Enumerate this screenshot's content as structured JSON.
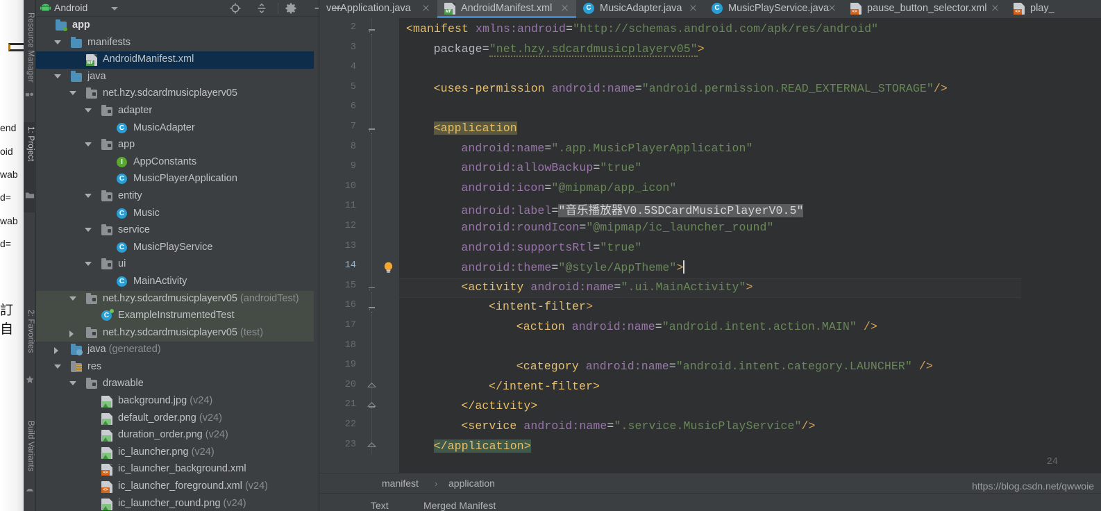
{
  "background_window": {
    "fragments": [
      "end",
      "oid",
      "wab",
      "d=",
      "wab",
      "d="
    ],
    "cjk_fragment": "訂自"
  },
  "tool_strip": {
    "items": [
      {
        "label": "Resource Manager",
        "icon": "resource-manager-icon",
        "active": false
      },
      {
        "label": "1: Project",
        "icon": "project-folder-icon",
        "active": true
      },
      {
        "label": "2: Favorites",
        "icon": "star-icon",
        "active": false
      },
      {
        "label": "Build Variants",
        "icon": "build-variants-icon",
        "active": false
      }
    ]
  },
  "project_panel": {
    "title": "Android",
    "dropdown_icon": "chevron-down-icon",
    "android_icon": "android-robot-icon",
    "header_icons": [
      "locate-target-icon",
      "collapse-all-icon",
      "gear-icon",
      "minimize-icon"
    ],
    "tree": [
      {
        "label": "app",
        "suffix": "",
        "depth": 0,
        "icon": "folder-module",
        "arrow": "",
        "bold": true,
        "selected": false,
        "testbg": false
      },
      {
        "label": "manifests",
        "suffix": "",
        "depth": 1,
        "icon": "folder-blue",
        "arrow": "open",
        "bold": false,
        "selected": false,
        "testbg": false
      },
      {
        "label": "AndroidManifest.xml",
        "suffix": "",
        "depth": 2,
        "icon": "file-mf",
        "arrow": "",
        "bold": false,
        "selected": true,
        "testbg": false
      },
      {
        "label": "java",
        "suffix": "",
        "depth": 1,
        "icon": "folder-blue",
        "arrow": "open",
        "bold": false,
        "selected": false,
        "testbg": false
      },
      {
        "label": "net.hzy.sdcardmusicplayerv05",
        "suffix": "",
        "depth": 2,
        "icon": "folder-pkg",
        "arrow": "open",
        "bold": false,
        "selected": false,
        "testbg": false
      },
      {
        "label": "adapter",
        "suffix": "",
        "depth": 3,
        "icon": "folder-pkg",
        "arrow": "open",
        "bold": false,
        "selected": false,
        "testbg": false
      },
      {
        "label": "MusicAdapter",
        "suffix": "",
        "depth": 4,
        "icon": "class",
        "arrow": "",
        "bold": false,
        "selected": false,
        "testbg": false
      },
      {
        "label": "app",
        "suffix": "",
        "depth": 3,
        "icon": "folder-pkg",
        "arrow": "open",
        "bold": false,
        "selected": false,
        "testbg": false
      },
      {
        "label": "AppConstants",
        "suffix": "",
        "depth": 4,
        "icon": "interface",
        "arrow": "",
        "bold": false,
        "selected": false,
        "testbg": false
      },
      {
        "label": "MusicPlayerApplication",
        "suffix": "",
        "depth": 4,
        "icon": "class",
        "arrow": "",
        "bold": false,
        "selected": false,
        "testbg": false
      },
      {
        "label": "entity",
        "suffix": "",
        "depth": 3,
        "icon": "folder-pkg",
        "arrow": "open",
        "bold": false,
        "selected": false,
        "testbg": false
      },
      {
        "label": "Music",
        "suffix": "",
        "depth": 4,
        "icon": "class",
        "arrow": "",
        "bold": false,
        "selected": false,
        "testbg": false
      },
      {
        "label": "service",
        "suffix": "",
        "depth": 3,
        "icon": "folder-pkg",
        "arrow": "open",
        "bold": false,
        "selected": false,
        "testbg": false
      },
      {
        "label": "MusicPlayService",
        "suffix": "",
        "depth": 4,
        "icon": "class",
        "arrow": "",
        "bold": false,
        "selected": false,
        "testbg": false
      },
      {
        "label": "ui",
        "suffix": "",
        "depth": 3,
        "icon": "folder-pkg",
        "arrow": "open",
        "bold": false,
        "selected": false,
        "testbg": false
      },
      {
        "label": "MainActivity",
        "suffix": "",
        "depth": 4,
        "icon": "class",
        "arrow": "",
        "bold": false,
        "selected": false,
        "testbg": false
      },
      {
        "label": "net.hzy.sdcardmusicplayerv05",
        "suffix": " (androidTest)",
        "depth": 2,
        "icon": "folder-pkg",
        "arrow": "open",
        "bold": false,
        "selected": false,
        "testbg": true
      },
      {
        "label": "ExampleInstrumentedTest",
        "suffix": "",
        "depth": 3,
        "icon": "class-test",
        "arrow": "",
        "bold": false,
        "selected": false,
        "testbg": true
      },
      {
        "label": "net.hzy.sdcardmusicplayerv05",
        "suffix": " (test)",
        "depth": 2,
        "icon": "folder-pkg",
        "arrow": "closed",
        "bold": false,
        "selected": false,
        "testbg": true
      },
      {
        "label": "java",
        "suffix": " (generated)",
        "depth": 1,
        "icon": "folder-generated",
        "arrow": "closed",
        "bold": false,
        "selected": false,
        "testbg": false
      },
      {
        "label": "res",
        "suffix": "",
        "depth": 1,
        "icon": "folder-res",
        "arrow": "open",
        "bold": false,
        "selected": false,
        "testbg": false
      },
      {
        "label": "drawable",
        "suffix": "",
        "depth": 2,
        "icon": "folder-pkg",
        "arrow": "open",
        "bold": false,
        "selected": false,
        "testbg": false
      },
      {
        "label": "background.jpg",
        "suffix": " (v24)",
        "depth": 3,
        "icon": "file-image",
        "arrow": "",
        "bold": false,
        "selected": false,
        "testbg": false
      },
      {
        "label": "default_order.png",
        "suffix": " (v24)",
        "depth": 3,
        "icon": "file-image",
        "arrow": "",
        "bold": false,
        "selected": false,
        "testbg": false
      },
      {
        "label": "duration_order.png",
        "suffix": " (v24)",
        "depth": 3,
        "icon": "file-image",
        "arrow": "",
        "bold": false,
        "selected": false,
        "testbg": false
      },
      {
        "label": "ic_launcher.png",
        "suffix": " (v24)",
        "depth": 3,
        "icon": "file-image",
        "arrow": "",
        "bold": false,
        "selected": false,
        "testbg": false
      },
      {
        "label": "ic_launcher_background.xml",
        "suffix": "",
        "depth": 3,
        "icon": "file-xml",
        "arrow": "",
        "bold": false,
        "selected": false,
        "testbg": false
      },
      {
        "label": "ic_launcher_foreground.xml",
        "suffix": " (v24)",
        "depth": 3,
        "icon": "file-xml",
        "arrow": "",
        "bold": false,
        "selected": false,
        "testbg": false
      },
      {
        "label": "ic_launcher_round.png",
        "suffix": " (v24)",
        "depth": 3,
        "icon": "file-image",
        "arrow": "",
        "bold": false,
        "selected": false,
        "testbg": false
      }
    ]
  },
  "editor_tabs": [
    {
      "label": "verApplication.java",
      "icon": "java-class-icon",
      "active": false,
      "truncated_left": true
    },
    {
      "label": "AndroidManifest.xml",
      "icon": "manifest-file-icon",
      "active": true,
      "truncated_left": false
    },
    {
      "label": "MusicAdapter.java",
      "icon": "java-class-icon",
      "active": false,
      "truncated_left": false
    },
    {
      "label": "MusicPlayService.java",
      "icon": "java-class-icon",
      "active": false,
      "truncated_left": false
    },
    {
      "label": "pause_button_selector.xml",
      "icon": "xml-file-icon",
      "active": false,
      "truncated_left": false
    },
    {
      "label": "play_",
      "icon": "xml-file-icon",
      "active": false,
      "truncated_left": false
    }
  ],
  "code": {
    "first_visible_line": 2,
    "last_visible_line": 24,
    "current_line": 14,
    "lines": [
      {
        "n": 2,
        "fold": "minus-top",
        "segs": [
          {
            "t": "<manifest",
            "c": "tag"
          },
          {
            "t": " ",
            "c": "plain"
          },
          {
            "t": "xmlns:android",
            "c": "attr"
          },
          {
            "t": "=",
            "c": "eq"
          },
          {
            "t": "\"http://schemas.android.com/apk/res/android\"",
            "c": "str"
          }
        ],
        "indent": 0
      },
      {
        "n": 3,
        "fold": "",
        "segs": [
          {
            "t": "package",
            "c": "attrname"
          },
          {
            "t": "=",
            "c": "eq"
          },
          {
            "t": "\"net.hzy.sdcardmusicplayerv05\"",
            "c": "str-squiggle"
          },
          {
            "t": ">",
            "c": "punct"
          }
        ],
        "indent": 4
      },
      {
        "n": 4,
        "fold": "",
        "segs": [],
        "indent": 0
      },
      {
        "n": 5,
        "fold": "",
        "segs": [
          {
            "t": "<uses-permission",
            "c": "tag"
          },
          {
            "t": " ",
            "c": "plain"
          },
          {
            "t": "android:name",
            "c": "attr"
          },
          {
            "t": "=",
            "c": "eq"
          },
          {
            "t": "\"android.permission.READ_EXTERNAL_STORAGE\"",
            "c": "str"
          },
          {
            "t": "/>",
            "c": "punct"
          }
        ],
        "indent": 4
      },
      {
        "n": 6,
        "fold": "",
        "segs": [],
        "indent": 0
      },
      {
        "n": 7,
        "fold": "minus",
        "segs": [
          {
            "t": "<application",
            "c": "tag-hl"
          }
        ],
        "indent": 4
      },
      {
        "n": 8,
        "fold": "",
        "segs": [
          {
            "t": "android:name",
            "c": "attr"
          },
          {
            "t": "=",
            "c": "eq"
          },
          {
            "t": "\".app.MusicPlayerApplication\"",
            "c": "str"
          }
        ],
        "indent": 8
      },
      {
        "n": 9,
        "fold": "",
        "segs": [
          {
            "t": "android:allowBackup",
            "c": "attr"
          },
          {
            "t": "=",
            "c": "eq"
          },
          {
            "t": "\"true\"",
            "c": "str"
          }
        ],
        "indent": 8
      },
      {
        "n": 10,
        "fold": "",
        "segs": [
          {
            "t": "android:icon",
            "c": "attr"
          },
          {
            "t": "=",
            "c": "eq"
          },
          {
            "t": "\"@mipmap/app_icon\"",
            "c": "str"
          }
        ],
        "indent": 8
      },
      {
        "n": 11,
        "fold": "",
        "segs": [
          {
            "t": "android:label",
            "c": "attr"
          },
          {
            "t": "=",
            "c": "eq"
          },
          {
            "t": "\"音乐播放器V0.5SDCardMusicPlayerV0.5\"",
            "c": "str-sel"
          }
        ],
        "indent": 8
      },
      {
        "n": 12,
        "fold": "",
        "segs": [
          {
            "t": "android:roundIcon",
            "c": "attr"
          },
          {
            "t": "=",
            "c": "eq"
          },
          {
            "t": "\"@mipmap/ic_launcher_round\"",
            "c": "str"
          }
        ],
        "indent": 8
      },
      {
        "n": 13,
        "fold": "",
        "segs": [
          {
            "t": "android:supportsRtl",
            "c": "attr"
          },
          {
            "t": "=",
            "c": "eq"
          },
          {
            "t": "\"true\"",
            "c": "str"
          }
        ],
        "indent": 8
      },
      {
        "n": 14,
        "fold": "",
        "segs": [
          {
            "t": "android:theme",
            "c": "attr"
          },
          {
            "t": "=",
            "c": "eq"
          },
          {
            "t": "\"@style/AppTheme\"",
            "c": "str"
          },
          {
            "t": ">",
            "c": "punct"
          }
        ],
        "indent": 8,
        "bulb": true,
        "caret_after": true
      },
      {
        "n": 15,
        "fold": "minus",
        "segs": [
          {
            "t": "<activity",
            "c": "tag"
          },
          {
            "t": " ",
            "c": "plain"
          },
          {
            "t": "android:name",
            "c": "attr"
          },
          {
            "t": "=",
            "c": "eq"
          },
          {
            "t": "\".ui.MainActivity\"",
            "c": "str"
          },
          {
            "t": ">",
            "c": "punct"
          }
        ],
        "indent": 8
      },
      {
        "n": 16,
        "fold": "minus",
        "segs": [
          {
            "t": "<intent-filter",
            "c": "tag"
          },
          {
            "t": ">",
            "c": "punct"
          }
        ],
        "indent": 12
      },
      {
        "n": 17,
        "fold": "",
        "segs": [
          {
            "t": "<action",
            "c": "tag"
          },
          {
            "t": " ",
            "c": "plain"
          },
          {
            "t": "android:name",
            "c": "attr"
          },
          {
            "t": "=",
            "c": "eq"
          },
          {
            "t": "\"android.intent.action.MAIN\"",
            "c": "str"
          },
          {
            "t": " ",
            "c": "plain"
          },
          {
            "t": "/>",
            "c": "punct"
          }
        ],
        "indent": 16
      },
      {
        "n": 18,
        "fold": "",
        "segs": [],
        "indent": 0
      },
      {
        "n": 19,
        "fold": "",
        "segs": [
          {
            "t": "<category",
            "c": "tag"
          },
          {
            "t": " ",
            "c": "plain"
          },
          {
            "t": "android:name",
            "c": "attr"
          },
          {
            "t": "=",
            "c": "eq"
          },
          {
            "t": "\"android.intent.category.LAUNCHER\"",
            "c": "str"
          },
          {
            "t": " ",
            "c": "plain"
          },
          {
            "t": "/>",
            "c": "punct"
          }
        ],
        "indent": 16
      },
      {
        "n": 20,
        "fold": "plus-end",
        "segs": [
          {
            "t": "</intent-filter>",
            "c": "tag"
          }
        ],
        "indent": 12
      },
      {
        "n": 21,
        "fold": "plus-end",
        "segs": [
          {
            "t": "</activity>",
            "c": "tag"
          }
        ],
        "indent": 8
      },
      {
        "n": 22,
        "fold": "",
        "segs": [
          {
            "t": "<service",
            "c": "tag"
          },
          {
            "t": " ",
            "c": "plain"
          },
          {
            "t": "android:name",
            "c": "attr"
          },
          {
            "t": "=",
            "c": "eq"
          },
          {
            "t": "\".service.MusicPlayService\"",
            "c": "str"
          },
          {
            "t": "/>",
            "c": "punct"
          }
        ],
        "indent": 8
      },
      {
        "n": 23,
        "fold": "plus-end",
        "segs": [
          {
            "t": "</application>",
            "c": "tag-hl2"
          }
        ],
        "indent": 4
      },
      {
        "n": 24,
        "fold": "",
        "segs": [],
        "indent": 0
      }
    ]
  },
  "breadcrumb": {
    "items": [
      "manifest",
      "application"
    ],
    "separator": "›"
  },
  "bottom_tabs": [
    {
      "label": "Text"
    },
    {
      "label": "Merged Manifest"
    }
  ],
  "watermark": "https://blog.csdn.net/qwwoie",
  "colors": {
    "panel_bg": "#3c3f41",
    "editor_bg": "#2f3032",
    "selection_blue": "#0d2d4a",
    "tab_active": "#4e5254",
    "tab_underline": "#3d86d0",
    "tag": "#e8bf6a",
    "attr": "#9876aa",
    "string": "#6a8759",
    "test_bg": "#454b45"
  }
}
